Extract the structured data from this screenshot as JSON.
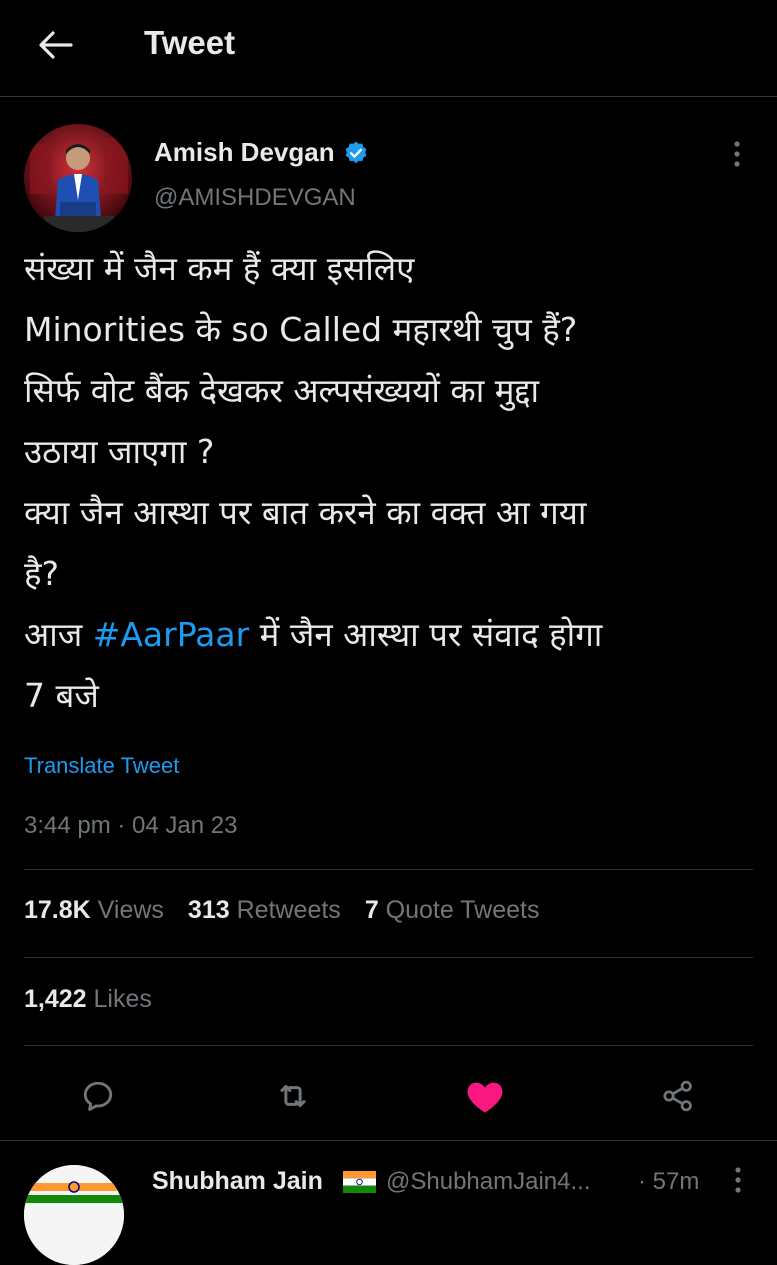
{
  "header": {
    "title": "Tweet",
    "back_icon": "arrow-left-icon"
  },
  "author": {
    "name": "Amish Devgan",
    "handle": "@AMISHDEVGAN",
    "verified_icon": "verified-badge-icon"
  },
  "tweet": {
    "lines": [
      "संख्या में जैन कम हैं क्या इसलिए",
      "Minorities के so Called महारथी चुप हैं?",
      "सिर्फ वोट बैंक देखकर अल्पसंख्ययों का मुद्दा",
      "उठाया जाएगा ?",
      "क्या जैन आस्था पर बात करने का वक्त आ गया",
      "है?"
    ],
    "line7_before": "आज ",
    "hashtag": "#AarPaar",
    "line7_after": " में जैन आस्था पर संवाद होगा",
    "line8": "7 बजे",
    "translate": "Translate Tweet",
    "timestamp": "3:44 pm · 04 Jan 23"
  },
  "stats": {
    "views_count": "17.8K",
    "views_label": "Views",
    "retweets_count": "313",
    "retweets_label": "Retweets",
    "quotes_count": "7",
    "quotes_label": "Quote Tweets",
    "likes_count": "1,422",
    "likes_label": "Likes"
  },
  "actions": {
    "reply_icon": "reply-icon",
    "retweet_icon": "retweet-icon",
    "like_icon": "heart-icon",
    "share_icon": "share-icon",
    "like_color": "#f91880"
  },
  "reply": {
    "name": "Shubham Jain",
    "handle": "@ShubhamJain4...",
    "time": "· 57m"
  },
  "colors": {
    "background": "#000000",
    "text": "#e7e9ea",
    "muted": "#71767b",
    "accent": "#1d9bf0",
    "divider": "#2f3336"
  }
}
